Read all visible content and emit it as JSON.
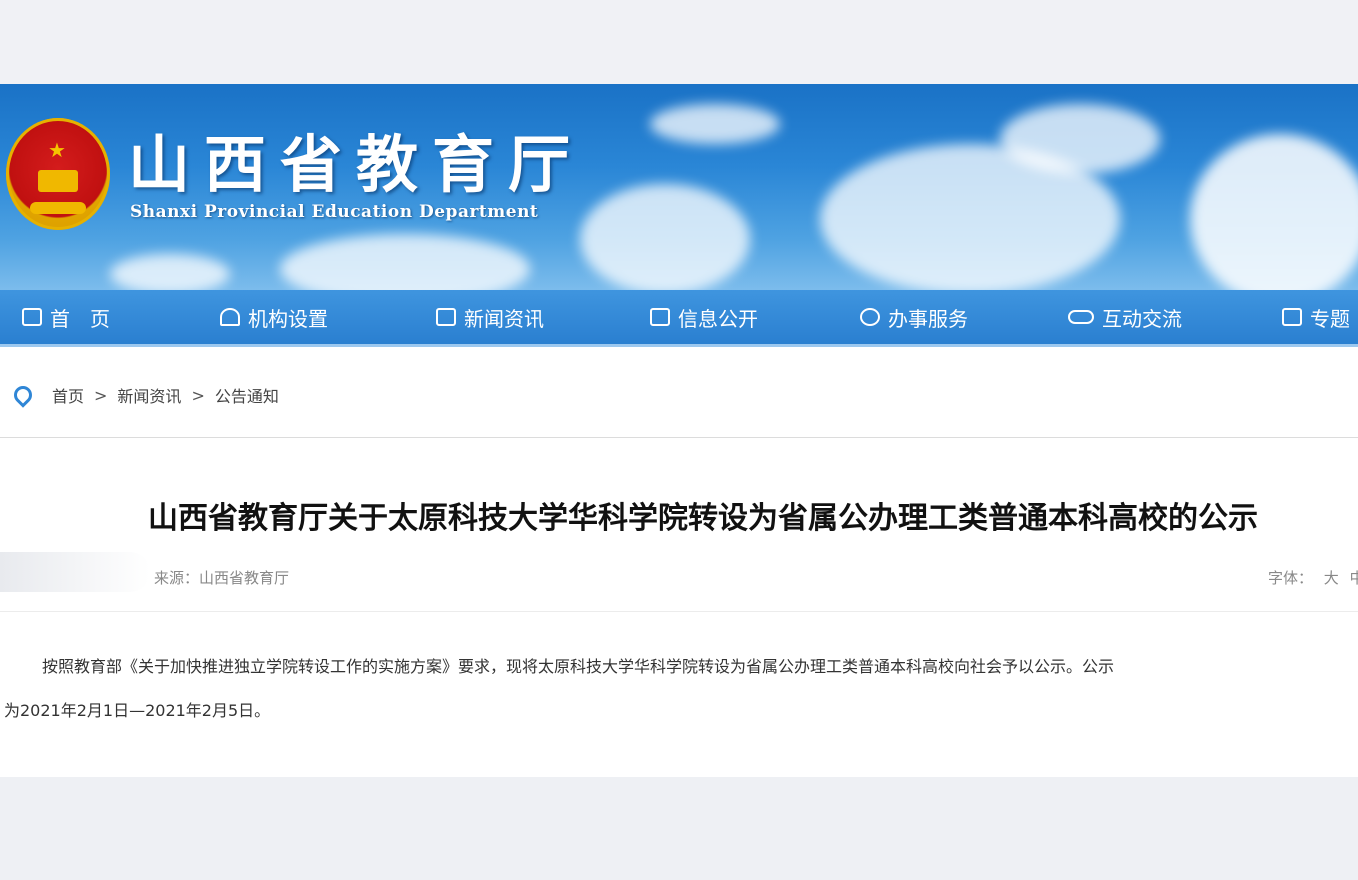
{
  "site": {
    "title": "山西省教育厅",
    "subtitle": "Shanxi Provincial Education Department"
  },
  "nav": {
    "items": [
      {
        "label": "首　页",
        "icon": "home-icon"
      },
      {
        "label": "机构设置",
        "icon": "org-icon"
      },
      {
        "label": "新闻资讯",
        "icon": "news-icon"
      },
      {
        "label": "信息公开",
        "icon": "info-icon"
      },
      {
        "label": "办事服务",
        "icon": "service-icon"
      },
      {
        "label": "互动交流",
        "icon": "chat-icon"
      },
      {
        "label": "专题",
        "icon": "topic-icon"
      }
    ]
  },
  "breadcrumb": {
    "items": [
      "首页",
      "新闻资讯",
      "公告通知"
    ],
    "separator": ">"
  },
  "article": {
    "title": "山西省教育厅关于太原科技大学华科学院转设为省属公办理工类普通本科高校的公示",
    "source": "来源：山西省教育厅",
    "font_label": "字体：",
    "font_large": "大",
    "font_medium": "中",
    "line1": "按照教育部《关于加快推进独立学院转设工作的实施方案》要求，现将太原科技大学华科学院转设为省属公办理工类普通本科高校向社会予以公示。公示",
    "line2": "为2021年2月1日—2021年2月5日。"
  },
  "colors": {
    "banner": "#2a86d6",
    "nav": "#2f86d6",
    "emblem_red": "#c01010",
    "emblem_gold": "#e6b100"
  }
}
